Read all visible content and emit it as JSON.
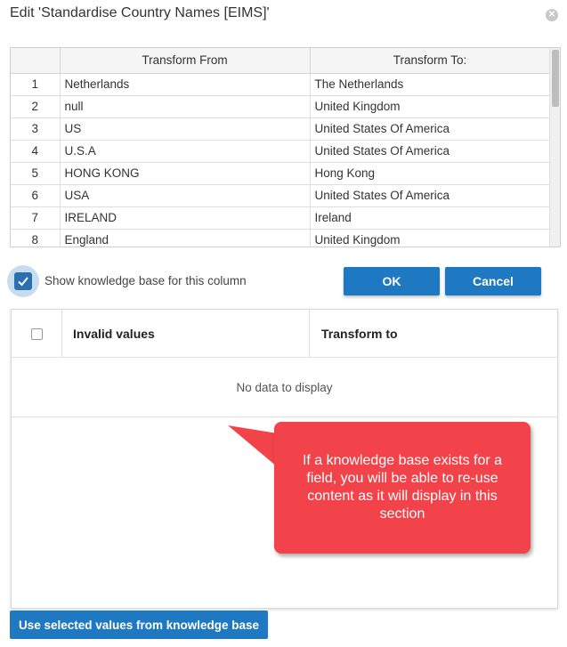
{
  "dialog": {
    "title": "Edit 'Standardise Country Names [EIMS]'",
    "close_icon": "close-icon"
  },
  "transform_grid": {
    "columns": [
      "",
      "Transform From",
      "Transform To:"
    ],
    "rows": [
      {
        "num": "1",
        "from": "Netherlands",
        "to": "The Netherlands"
      },
      {
        "num": "2",
        "from": "null",
        "to": "United Kingdom"
      },
      {
        "num": "3",
        "from": "US",
        "to": "United States Of America"
      },
      {
        "num": "4",
        "from": "U.S.A",
        "to": "United States Of America"
      },
      {
        "num": "5",
        "from": "HONG KONG",
        "to": "Hong Kong"
      },
      {
        "num": "6",
        "from": "USA",
        "to": "United States Of America"
      },
      {
        "num": "7",
        "from": "IRELAND",
        "to": "Ireland"
      },
      {
        "num": "8",
        "from": "England",
        "to": "United Kingdom"
      }
    ]
  },
  "knowledge_base": {
    "show_label": "Show knowledge base for this column",
    "show_checked": true,
    "columns": {
      "invalid": "Invalid values",
      "transform": "Transform to"
    },
    "empty_text": "No data to display",
    "use_button": "Use selected values from knowledge base"
  },
  "buttons": {
    "ok": "OK",
    "cancel": "Cancel"
  },
  "callout": {
    "text": "If a knowledge base exists for a field, you will be able to re-use content as it will display in this section"
  },
  "colors": {
    "primary": "#1f79c2",
    "callout": "#f2434a",
    "checkbox_highlight": "#c7dcef"
  }
}
